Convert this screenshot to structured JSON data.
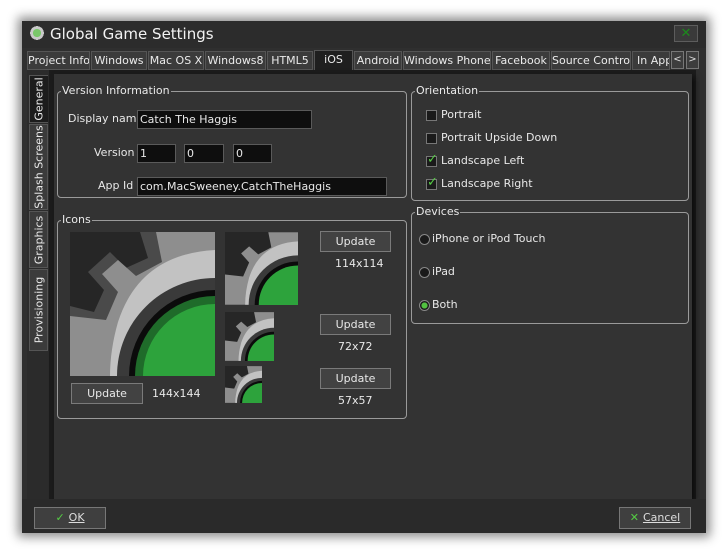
{
  "window": {
    "title": "Global Game Settings",
    "close_symbol": "✕"
  },
  "tabs": [
    "Project Info",
    "Windows",
    "Mac OS X",
    "Windows8",
    "HTML5",
    "iOS",
    "Android",
    "Windows Phone",
    "Facebook",
    "Source Control",
    "In App"
  ],
  "active_tab": "iOS",
  "tab_scroll": {
    "left": "<",
    "right": ">"
  },
  "side_tabs": [
    "General",
    "Splash Screens",
    "Graphics",
    "Provisioning"
  ],
  "active_side_tab": "General",
  "version_info": {
    "legend": "Version Information",
    "display_name_label": "Display name",
    "display_name_value": "Catch The Haggis",
    "version_label": "Version",
    "version_major": "1",
    "version_minor": "0",
    "version_patch": "0",
    "app_id_label": "App Id",
    "app_id_value": "com.MacSweeney.CatchTheHaggis"
  },
  "icons": {
    "legend": "Icons",
    "update_label": "Update",
    "size_large": "144x144",
    "size_114": "114x114",
    "size_72": "72x72",
    "size_57": "57x57"
  },
  "orientation": {
    "legend": "Orientation",
    "options": [
      {
        "label": "Portrait",
        "checked": false
      },
      {
        "label": "Portrait Upside Down",
        "checked": false
      },
      {
        "label": "Landscape Left",
        "checked": true
      },
      {
        "label": "Landscape Right",
        "checked": true
      }
    ]
  },
  "devices": {
    "legend": "Devices",
    "options": [
      {
        "label": "iPhone or iPod Touch",
        "selected": false
      },
      {
        "label": "iPad",
        "selected": false
      },
      {
        "label": "Both",
        "selected": true
      }
    ]
  },
  "footer": {
    "ok_label": "OK",
    "cancel_label": "Cancel"
  },
  "colors": {
    "accent": "#52c241",
    "panel": "#333333",
    "background": "#1c1c1c"
  }
}
